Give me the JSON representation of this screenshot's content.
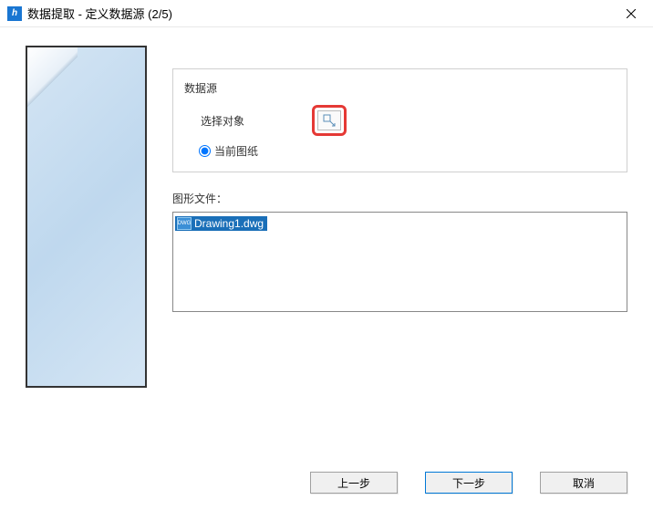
{
  "window": {
    "title": "数据提取 - 定义数据源 (2/5)"
  },
  "dataSource": {
    "groupTitle": "数据源",
    "selectObjectsLabel": "选择对象",
    "currentDrawingLabel": "当前图纸"
  },
  "drawingFiles": {
    "label": "图形文件：",
    "items": [
      "Drawing1.dwg"
    ]
  },
  "buttons": {
    "prev": "上一步",
    "next": "下一步",
    "cancel": "取消"
  }
}
